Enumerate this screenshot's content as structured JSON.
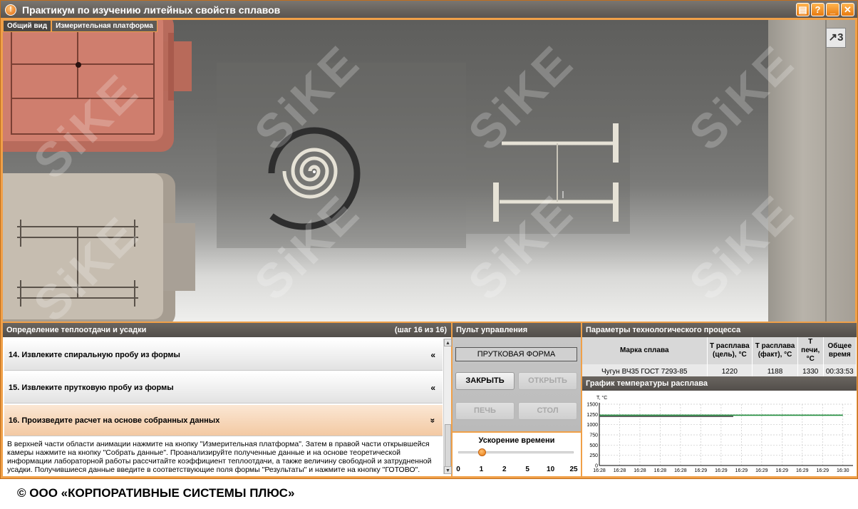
{
  "window": {
    "title": "Практикум по изучению литейных свойств сплавов",
    "buttons": [
      "▤",
      "?",
      "_",
      "✕"
    ]
  },
  "tabs": [
    {
      "label": "Общий вид",
      "active": false
    },
    {
      "label": "Измерительная платформа",
      "active": true
    }
  ],
  "scene": {
    "camera_button": "↗3",
    "watermark": "SiKE"
  },
  "steps_panel": {
    "title": "Определение теплоотдачи и усадки",
    "step_counter": "(шаг 16 из 16)",
    "steps": [
      {
        "label": "14. Извлеките спиральную пробу из формы",
        "arrow": "«",
        "active": false
      },
      {
        "label": "15. Извлеките прутковую пробу из формы",
        "arrow": "«",
        "active": false
      },
      {
        "label": "16. Произведите расчет на основе собранных данных",
        "arrow": "»",
        "active": true
      }
    ],
    "description": "В верхней части области анимации нажмите на кнопку \"Измерительная платформа\". Затем в правой части открывшейся камеры нажмите на кнопку \"Собрать данные\". Проанализируйте полученные данные и на основе теоретической информации лабораторной работы рассчитайте коэффициент теплоотдачи, а также величину свободной и затрудненной усадки. Получившиеся данные введите в соответствующие поля формы \"Результаты\" и нажмите на кнопку \"ГОТОВО\"."
  },
  "control_panel": {
    "title": "Пульт управления",
    "form_label": "ПРУТКОВАЯ ФОРМА",
    "close_button": "ЗАКРЫТЬ",
    "open_button": "ОТКРЫТЬ",
    "furnace_button": "ПЕЧЬ",
    "table_button": "СТОЛ",
    "speed_title": "Ускорение времени",
    "speed_ticks": [
      "0",
      "1",
      "2",
      "5",
      "10",
      "25"
    ],
    "speed_value": 1
  },
  "params_panel": {
    "title": "Параметры технологического процесса",
    "headers": [
      "Марка сплава",
      "T расплава (цель), °C",
      "T расплава (факт), °C",
      "T печи, °C",
      "Общее время"
    ],
    "row": [
      "Чугун ВЧ35 ГОСТ 7293-85",
      "1220",
      "1188",
      "1330",
      "00:33:53"
    ]
  },
  "chart_panel": {
    "title": "График температуры расплава"
  },
  "chart_data": {
    "type": "line",
    "title": "",
    "ylabel": "T, °C",
    "xlabel": "",
    "ylim": [
      0,
      1500
    ],
    "y_ticks": [
      0,
      250,
      500,
      750,
      1000,
      1250,
      1500
    ],
    "x_ticks": [
      "16:28",
      "16:28",
      "16:28",
      "16:28",
      "16:28",
      "16:29",
      "16:29",
      "16:29",
      "16:29",
      "16:29",
      "16:29",
      "16:29",
      "16:30"
    ],
    "grid": true,
    "series": [
      {
        "color": "#1e8c3a",
        "x": [
          0,
          12
        ],
        "values": [
          1230,
          1230
        ]
      },
      {
        "color": "#555555",
        "x": [
          0,
          6.6
        ],
        "values": [
          1200,
          1200
        ]
      }
    ]
  },
  "copyright": "© ООО «КОРПОРАТИВНЫЕ СИСТЕМЫ ПЛЮС»"
}
